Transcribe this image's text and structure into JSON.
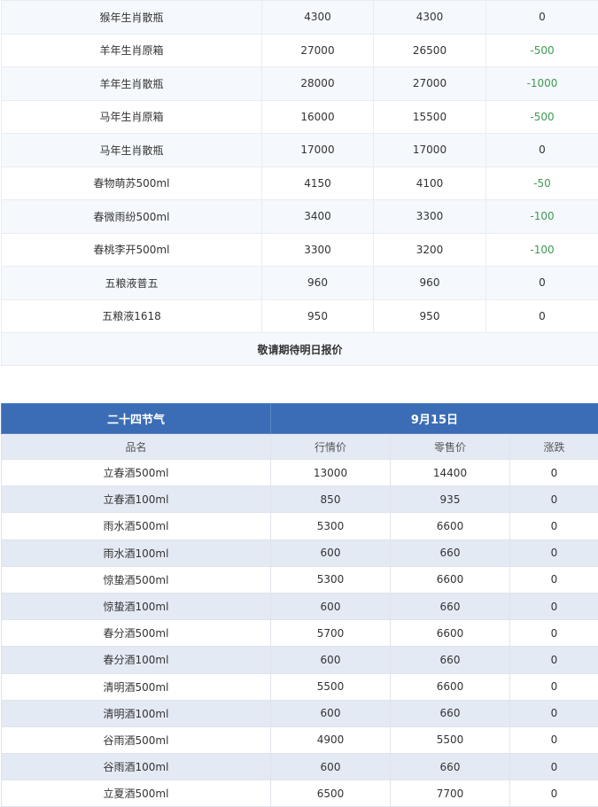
{
  "table1": {
    "rows": [
      {
        "name": "猴年生肖散瓶",
        "market": "4300",
        "retail": "4300",
        "change": "0"
      },
      {
        "name": "羊年生肖原箱",
        "market": "27000",
        "retail": "26500",
        "change": "-500"
      },
      {
        "name": "羊年生肖散瓶",
        "market": "28000",
        "retail": "27000",
        "change": "-1000"
      },
      {
        "name": "马年生肖原箱",
        "market": "16000",
        "retail": "15500",
        "change": "-500"
      },
      {
        "name": "马年生肖散瓶",
        "market": "17000",
        "retail": "17000",
        "change": "0"
      },
      {
        "name": "春物萌苏500ml",
        "market": "4150",
        "retail": "4100",
        "change": "-50"
      },
      {
        "name": "春微雨纷500ml",
        "market": "3400",
        "retail": "3300",
        "change": "-100"
      },
      {
        "name": "春桃李开500ml",
        "market": "3300",
        "retail": "3200",
        "change": "-100"
      },
      {
        "name": "五粮液普五",
        "market": "960",
        "retail": "960",
        "change": "0"
      },
      {
        "name": "五粮液1618",
        "market": "950",
        "retail": "950",
        "change": "0"
      }
    ],
    "note": "敬请期待明日报价"
  },
  "table2": {
    "title": "二十四节气",
    "date": "9月15日",
    "headers": {
      "name": "品名",
      "market": "行情价",
      "retail": "零售价",
      "change": "涨跌"
    },
    "rows": [
      {
        "name": "立春酒500ml",
        "market": "13000",
        "retail": "14400",
        "change": "0"
      },
      {
        "name": "立春酒100ml",
        "market": "850",
        "retail": "935",
        "change": "0"
      },
      {
        "name": "雨水酒500ml",
        "market": "5300",
        "retail": "6600",
        "change": "0"
      },
      {
        "name": "雨水酒100ml",
        "market": "600",
        "retail": "660",
        "change": "0"
      },
      {
        "name": "惊蛰酒500ml",
        "market": "5300",
        "retail": "6600",
        "change": "0"
      },
      {
        "name": "惊蛰酒100ml",
        "market": "600",
        "retail": "660",
        "change": "0"
      },
      {
        "name": "春分酒500ml",
        "market": "5700",
        "retail": "6600",
        "change": "0"
      },
      {
        "name": "春分酒100ml",
        "market": "600",
        "retail": "660",
        "change": "0"
      },
      {
        "name": "清明酒500ml",
        "market": "5500",
        "retail": "6600",
        "change": "0"
      },
      {
        "name": "清明酒100ml",
        "market": "600",
        "retail": "660",
        "change": "0"
      },
      {
        "name": "谷雨酒500ml",
        "market": "4900",
        "retail": "5500",
        "change": "0"
      },
      {
        "name": "谷雨酒100ml",
        "market": "600",
        "retail": "660",
        "change": "0"
      },
      {
        "name": "立夏酒500ml",
        "market": "6500",
        "retail": "7700",
        "change": "0"
      }
    ]
  },
  "colors": {
    "header": "#3a6db5",
    "negative_change": "#3f9a52"
  }
}
